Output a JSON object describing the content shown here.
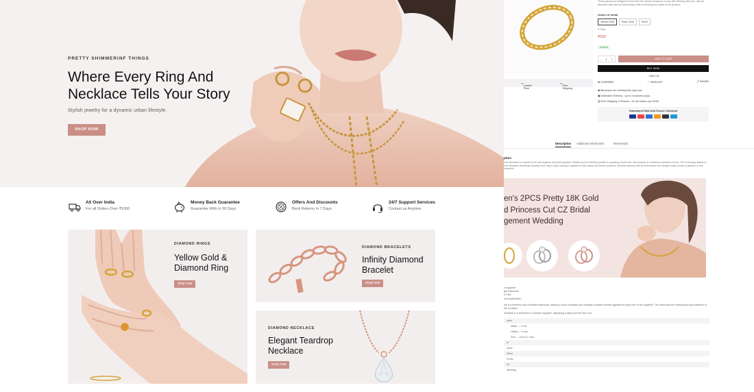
{
  "hero": {
    "eyebrow": "PRETTY SHIMMERINF THINGS",
    "title_line1": "Where Every Ring And",
    "title_line2": "Necklace Tells Your Story",
    "subtitle": "Stylish jewelry for a dynamic urban lifestyle.",
    "button": "SHOP NOW"
  },
  "features": [
    {
      "icon": "truck-icon",
      "title": "All Over India",
      "subtitle": "For all Orders Over ₹1000"
    },
    {
      "icon": "piggy-bank-icon",
      "title": "Money Back Guarantee",
      "subtitle": "Guarantee With In 30 Days"
    },
    {
      "icon": "discount-icon",
      "title": "Offers And Discounts",
      "subtitle": "Back Returns In 7 Days"
    },
    {
      "icon": "headset-icon",
      "title": "24/7 Support Services",
      "subtitle": "Contact us Anytime"
    }
  ],
  "banners": {
    "rings": {
      "eyebrow": "DIAMOND RINGS",
      "title_line1": "Yellow Gold &",
      "title_line2": "Diamond Ring",
      "button": "shop now"
    },
    "bracelets": {
      "eyebrow": "DIAMOND BRACELETS",
      "title_line1": "Infinity Diamond",
      "title_line2": "Bracelet",
      "button": "shop now"
    },
    "necklace": {
      "eyebrow": "DIAMOND NECKLACE",
      "title_line1": "Elegant Teardrop",
      "title_line2": "Necklace",
      "button": "shop now"
    }
  },
  "product": {
    "intro": "These pieces are designed to become the newest treasures in your life! Sterling with love, with an attractive style and an authenticity while embracing the depth of the product.",
    "metal_label": "choice of metal",
    "metal_options": [
      "Yellow Gold",
      "Rose Gold",
      "Silver"
    ],
    "carat": "₹ Glam",
    "price": "₹210",
    "stock": "in stock",
    "qty_minus": "-",
    "qty_value": "1",
    "qty_plus": "+",
    "add_to_cart": "ADD TO CART",
    "buy_now": "BUY NOW",
    "ask_us": "ASK US",
    "compare": "COMPARE",
    "wishlist": "WISHLIST",
    "share": "SHARE",
    "viewing_count": "24",
    "viewing_text": "people are viewing this right now",
    "delivery": "Estimated Delivery : up to 4 business days",
    "shipping": "Free Shipping & Returns : On all orders over $200",
    "checkout_title": "Guaranteed Safe And Secure Checkout",
    "strip_lowest": "Lowest Price",
    "strip_shipping": "Free Shipping",
    "tabs": [
      "Description",
      "Additional Information",
      "Reviews(0)"
    ],
    "desc_heading": "ption",
    "desc_text": "Intro Necklace is a symbol of all real elegance and enduring style. Whether you're meeting yourself or surprising a loved one, this necklace is a timeless expression of love. The 8 stunning shapes to form Necklace effortlessly transition from day to night, making it suitable for both casual and formal occasions. Whether adorned with its bold beauty, this necklace adds a touch of glamour to any ensemble.",
    "promo_line1": "en's 2PCS Pretty 18K Gold",
    "promo_line2": "d Princess Cut CZ Bridal",
    "promo_line3": "gement Wedding",
    "spec_lines": [
      "e Sapphire",
      "gle Diamonds",
      "k Gold",
      "ome Application"
    ],
    "spec_para": "ble is a timeless look of brilliant diamonds, adding a touch of sparkle and creating a radiant contrast against the deep blue of the sapphire. The diamonds are meticulously and brilliance of the necklace.",
    "spec_para2": "necklace is a testament to sublime sapphire, displaying a deep and rich blue hue.",
    "rows": [
      "neter",
      "Width — 4 mm",
      "Height — 5 mm",
      "Size — 18.00 (7 mm)",
      "ld",
      "stone",
      "Silver",
      "Pretty",
      "S1",
      "Wedding"
    ]
  },
  "colors": {
    "accent": "#c98f87",
    "hero_bg": "#f6f1f1",
    "banner_bg": "#f3eeee"
  }
}
